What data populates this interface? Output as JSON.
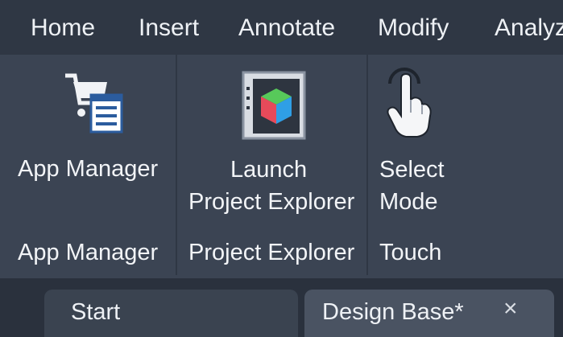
{
  "menu": {
    "items": [
      "Home",
      "Insert",
      "Annotate",
      "Modify",
      "Analyz"
    ]
  },
  "ribbon": {
    "panels": [
      {
        "title": "App Manager",
        "button": {
          "label_lines": [
            "App Manager"
          ],
          "icon": "app-manager-icon"
        }
      },
      {
        "title": "Project Explorer",
        "button": {
          "label_lines": [
            "Launch",
            "Project Explorer"
          ],
          "icon": "project-explorer-icon"
        }
      },
      {
        "title": "Touch",
        "button": {
          "label_lines": [
            "Select",
            "Mode"
          ],
          "icon": "touch-hand-icon"
        }
      }
    ]
  },
  "tabs": {
    "start": {
      "label": "Start"
    },
    "design": {
      "label": "Design Base*",
      "close": "×"
    }
  },
  "colors": {
    "menubar_bg": "#2f3744",
    "ribbon_bg": "#3b4453",
    "tab_active_bg": "#4a5362",
    "text": "#f2f4f7"
  }
}
